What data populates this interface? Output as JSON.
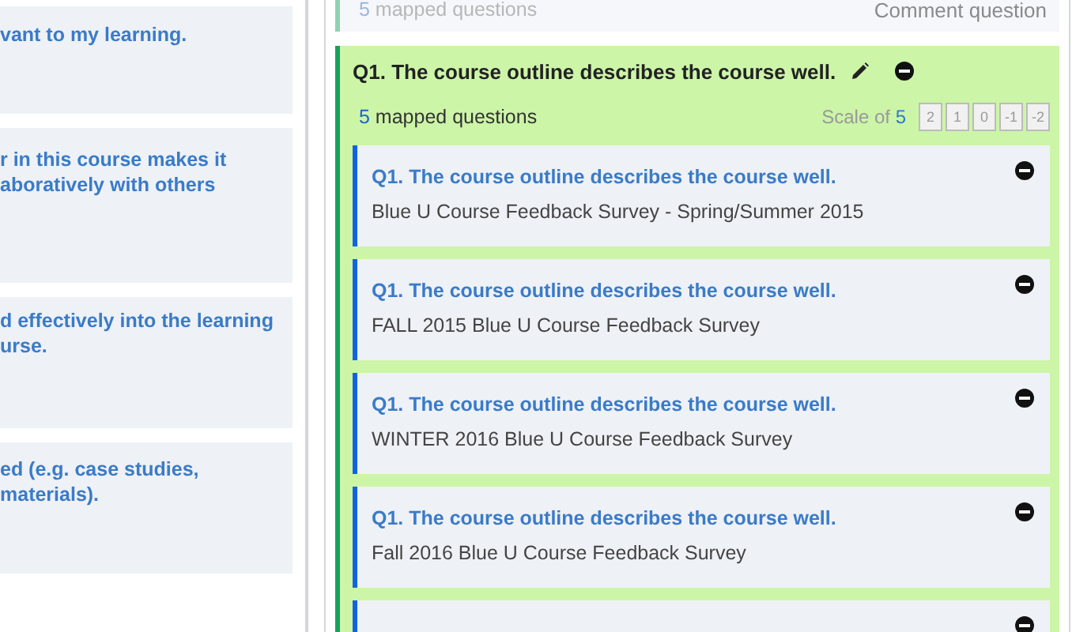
{
  "left_cards": [
    {
      "lines": [
        "vant to my learning."
      ]
    },
    {
      "lines": [
        "r in this course makes it",
        "aboratively with others"
      ]
    },
    {
      "lines": [
        "d effectively into the learning",
        "urse."
      ]
    },
    {
      "lines": [
        "ed (e.g. case studies,",
        "materials)."
      ]
    }
  ],
  "previous_group": {
    "count": "5",
    "count_label": "mapped questions",
    "action": "Comment question"
  },
  "group": {
    "title": "Q1. The course outline describes the course well.",
    "count": "5",
    "count_label": "mapped questions",
    "scale_label": "Scale of",
    "scale_value": "5",
    "scale": [
      "2",
      "1",
      "0",
      "-1",
      "-2"
    ],
    "items": [
      {
        "title": "Q1. The course outline describes the course well.",
        "survey": "Blue U Course Feedback Survey - Spring/Summer 2015"
      },
      {
        "title": "Q1. The course outline describes the course well.",
        "survey": "FALL 2015 Blue U Course Feedback Survey"
      },
      {
        "title": "Q1. The course outline describes the course well.",
        "survey": "WINTER 2016 Blue U Course Feedback Survey"
      },
      {
        "title": "Q1. The course outline describes the course well.",
        "survey": "Fall 2016 Blue U Course Feedback Survey"
      }
    ]
  }
}
